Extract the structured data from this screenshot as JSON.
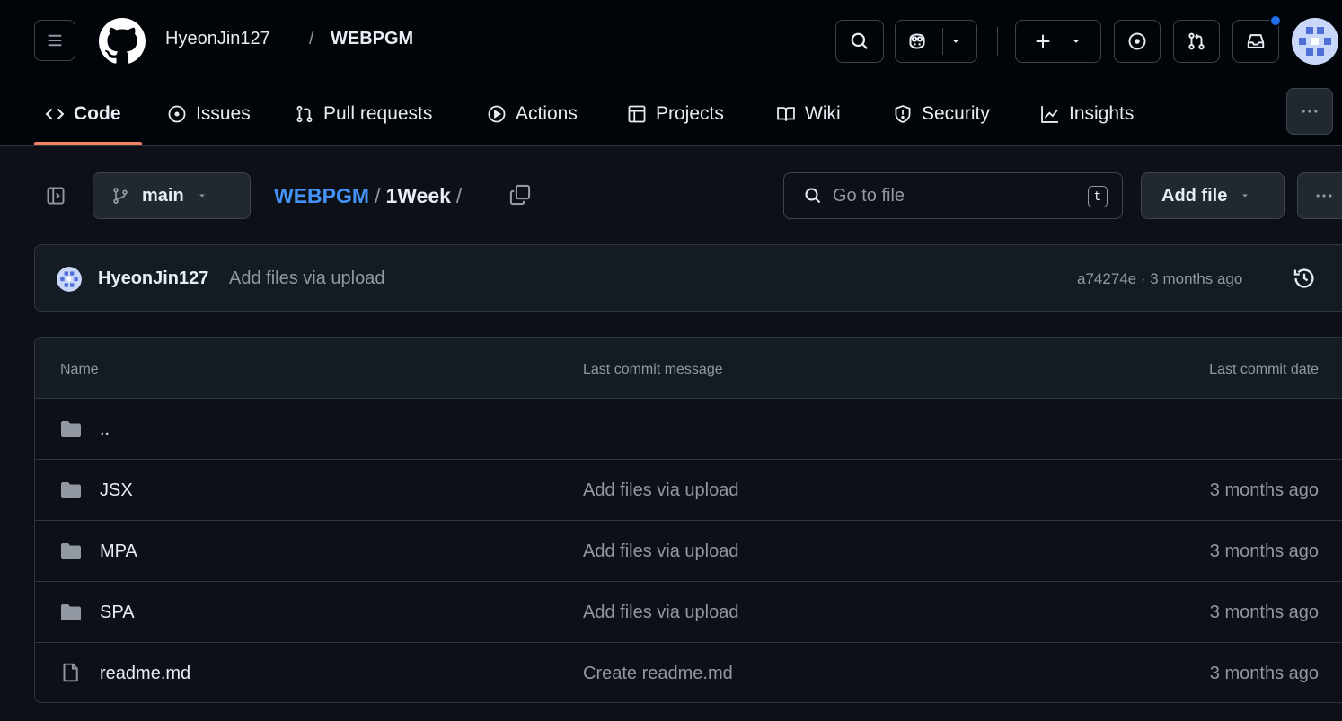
{
  "header": {
    "owner": "HyeonJin127",
    "separator": "/",
    "repo": "WEBPGM",
    "icons": [
      "hamburger-icon",
      "github-logo-icon",
      "search-icon",
      "copilot-icon",
      "plus-icon",
      "issue-icon",
      "pull-request-icon",
      "inbox-icon",
      "avatar"
    ],
    "notification_dot_color": "#1f6feb"
  },
  "tabs": [
    {
      "label": "Code",
      "icon": "code-icon",
      "active": true
    },
    {
      "label": "Issues",
      "icon": "issue-opened-icon"
    },
    {
      "label": "Pull requests",
      "icon": "git-pull-request-icon"
    },
    {
      "label": "Actions",
      "icon": "play-icon"
    },
    {
      "label": "Projects",
      "icon": "table-icon"
    },
    {
      "label": "Wiki",
      "icon": "book-icon"
    },
    {
      "label": "Security",
      "icon": "shield-icon"
    },
    {
      "label": "Insights",
      "icon": "graph-icon"
    }
  ],
  "toolbar": {
    "branch": "main",
    "path": {
      "root": "WEBPGM",
      "sep": "/",
      "current": "1Week",
      "trailing": "/"
    },
    "goto_placeholder": "Go to file",
    "goto_shortcut": "t",
    "add_file": "Add file"
  },
  "commit": {
    "author": "HyeonJin127",
    "message": "Add files via upload",
    "meta": "a74274e · 3 months ago"
  },
  "table": {
    "columns": {
      "name": "Name",
      "message": "Last commit message",
      "date": "Last commit date"
    },
    "parent": "..",
    "rows": [
      {
        "type": "folder",
        "name": "JSX",
        "message": "Add files via upload",
        "date": "3 months ago"
      },
      {
        "type": "folder",
        "name": "MPA",
        "message": "Add files via upload",
        "date": "3 months ago"
      },
      {
        "type": "folder",
        "name": "SPA",
        "message": "Add files via upload",
        "date": "3 months ago"
      },
      {
        "type": "file",
        "name": "readme.md",
        "message": "Create readme.md",
        "date": "3 months ago"
      }
    ]
  },
  "colors": {
    "background": "#0d1117",
    "header_bg": "#010409",
    "accent_link": "#4493f8",
    "active_tab_underline": "#f78166",
    "muted_text": "#9198a1"
  }
}
